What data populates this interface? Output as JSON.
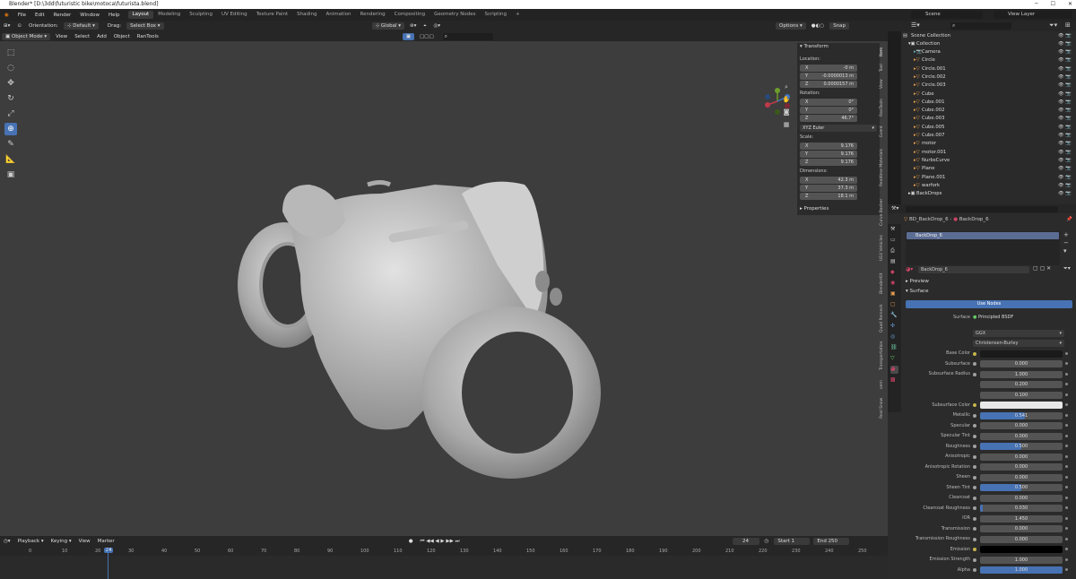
{
  "window": {
    "title": "Blender* [D:\\3dd\\futuristic bike\\motoca\\futurista.blend]"
  },
  "menu": [
    "File",
    "Edit",
    "Render",
    "Window",
    "Help"
  ],
  "workspaces": [
    "Layout",
    "Modeling",
    "Sculpting",
    "UV Editing",
    "Texture Paint",
    "Shading",
    "Animation",
    "Rendering",
    "Compositing",
    "Geometry Nodes",
    "Scripting",
    "+"
  ],
  "scene": {
    "name": "Scene",
    "view_layer": "View Layer"
  },
  "header": {
    "orientation_label": "Orientation:",
    "orientation_value": "Default",
    "drag_label": "Drag:",
    "drag_value": "Select Box",
    "transform_orientation": "Global",
    "options": "Options",
    "snap": "Snap"
  },
  "header2": {
    "mode": "Object Mode",
    "items": [
      "View",
      "Select",
      "Add",
      "Object",
      "RanTools"
    ]
  },
  "npanel": {
    "section": "Transform",
    "location_label": "Location:",
    "location": [
      {
        "axis": "X",
        "value": "-0 m"
      },
      {
        "axis": "Y",
        "value": "-0.0000013 m"
      },
      {
        "axis": "Z",
        "value": "0.0000157 m"
      }
    ],
    "rotation_label": "Rotation:",
    "rotation": [
      {
        "axis": "X",
        "value": "0°"
      },
      {
        "axis": "Y",
        "value": "0°"
      },
      {
        "axis": "Z",
        "value": "46.7°"
      }
    ],
    "rotation_mode": "XYZ Euler",
    "scale_label": "Scale:",
    "scale": [
      {
        "axis": "X",
        "value": "9.176"
      },
      {
        "axis": "Y",
        "value": "9.176"
      },
      {
        "axis": "Z",
        "value": "9.176"
      }
    ],
    "dimensions_label": "Dimensions:",
    "dimensions": [
      {
        "axis": "X",
        "value": "42.3 m"
      },
      {
        "axis": "Y",
        "value": "37.3 m"
      },
      {
        "axis": "Z",
        "value": "18.1 m"
      }
    ],
    "properties_section": "Properties"
  },
  "side_tabs": [
    "Item",
    "Tool",
    "View",
    "RanTools",
    "Event",
    "Realtime Materials",
    "Curve Basher",
    "UE4 Vehicles",
    "BlenderKit",
    "Quad Remesh",
    "Transportation",
    "oem",
    "Real Snow"
  ],
  "timeline": {
    "menus": [
      "Playback",
      "Keying",
      "View",
      "Marker"
    ],
    "current_frame": "24",
    "start_label": "Start",
    "start": "1",
    "end_label": "End",
    "end": "250",
    "ticks": [
      "0",
      "10",
      "20",
      "30",
      "40",
      "50",
      "60",
      "70",
      "80",
      "90",
      "100",
      "110",
      "120",
      "130",
      "140",
      "150",
      "160",
      "170",
      "180",
      "190",
      "200",
      "210",
      "220",
      "230",
      "240",
      "250"
    ]
  },
  "outliner": {
    "root": "Scene Collection",
    "collection": "Collection",
    "items": [
      "Camera",
      "Circle",
      "Circle.001",
      "Circle.002",
      "Circle.003",
      "Cube",
      "Cube.001",
      "Cube.002",
      "Cube.003",
      "Cube.005",
      "Cube.007",
      "motor",
      "motor.001",
      "NurbsCurve",
      "Plane",
      "Plane.001",
      "warfork",
      "BackDrops"
    ]
  },
  "properties": {
    "object_name": "BD_BackDrop_6",
    "material_name_header": "BackDrop_6",
    "slot_name": "BackDrop_6",
    "material_name": "BackDrop_6",
    "preview": "Preview",
    "surface": "Surface",
    "use_nodes": "Use Nodes",
    "surface_label": "Surface",
    "surface_value": "Principled BSDF",
    "distribution": "GGX",
    "subsurface_method": "Christensen-Burley",
    "rows": [
      {
        "label": "Base Color",
        "value": "",
        "fill": 0,
        "color": "#1a1a1a"
      },
      {
        "label": "Subsurface",
        "value": "0.000",
        "fill": 0
      },
      {
        "label": "Subsurface Radius",
        "value": "1.000",
        "fill": 0
      },
      {
        "label": "",
        "value": "0.200",
        "fill": 0
      },
      {
        "label": "",
        "value": "0.100",
        "fill": 0
      },
      {
        "label": "Subsurface Color",
        "value": "",
        "fill": 0,
        "color": "#e8e8e8"
      },
      {
        "label": "Metallic",
        "value": "0.541",
        "fill": 0.541
      },
      {
        "label": "Specular",
        "value": "0.000",
        "fill": 0
      },
      {
        "label": "Specular Tint",
        "value": "0.000",
        "fill": 0
      },
      {
        "label": "Roughness",
        "value": "0.500",
        "fill": 0.5
      },
      {
        "label": "Anisotropic",
        "value": "0.000",
        "fill": 0
      },
      {
        "label": "Anisotropic Rotation",
        "value": "0.000",
        "fill": 0
      },
      {
        "label": "Sheen",
        "value": "0.000",
        "fill": 0
      },
      {
        "label": "Sheen Tint",
        "value": "0.500",
        "fill": 0.5
      },
      {
        "label": "Clearcoat",
        "value": "0.000",
        "fill": 0
      },
      {
        "label": "Clearcoat Roughness",
        "value": "0.030",
        "fill": 0.03
      },
      {
        "label": "IOR",
        "value": "1.450",
        "fill": 0
      },
      {
        "label": "Transmission",
        "value": "0.000",
        "fill": 0
      },
      {
        "label": "Transmission Roughness",
        "value": "0.000",
        "fill": 0
      },
      {
        "label": "Emission",
        "value": "",
        "fill": 0,
        "color": "#000000"
      },
      {
        "label": "Emission Strength",
        "value": "1.000",
        "fill": 0
      },
      {
        "label": "Alpha",
        "value": "1.000",
        "fill": 1
      }
    ]
  },
  "colors": {
    "accent": "#4772b3",
    "viewport": "#3d3d3d",
    "panel": "#2b2b2b"
  }
}
